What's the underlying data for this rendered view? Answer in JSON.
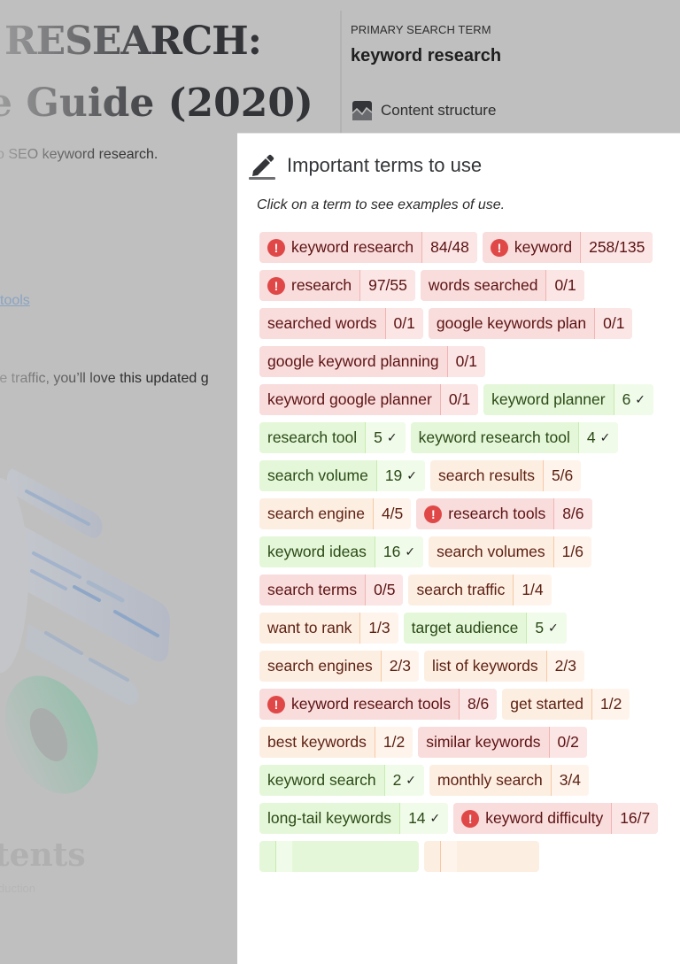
{
  "article": {
    "title_line1": "RESEARCH:",
    "title_line2": "e Guide (2020)",
    "subtitle": "o SEO keyword research.",
    "link_text": "tools",
    "paragraph": "re traffic, you’ll love this updated g",
    "contents_heading": "tents",
    "contents_item": "duction"
  },
  "sidebar": {
    "primary_label": "PRIMARY SEARCH TERM",
    "primary_value": "keyword research",
    "content_structure_label": "Content structure",
    "content_structure_icon": "chart-line-icon"
  },
  "panel": {
    "icon": "pencil-icon",
    "title": "Important terms to use",
    "hint": "Click on a term to see examples of use.",
    "status_colors": {
      "overused": "#f9dcdc",
      "good": "#e5f7d9",
      "underused": "#fdeee2",
      "alert": "#e04848"
    },
    "terms": [
      {
        "term": "keyword research",
        "count": "84/48",
        "status": "red",
        "alert": true
      },
      {
        "term": "keyword",
        "count": "258/135",
        "status": "red",
        "alert": true
      },
      {
        "term": "research",
        "count": "97/55",
        "status": "red",
        "alert": true
      },
      {
        "term": "words searched",
        "count": "0/1",
        "status": "red",
        "alert": false
      },
      {
        "term": "searched words",
        "count": "0/1",
        "status": "red",
        "alert": false
      },
      {
        "term": "google keywords plan",
        "count": "0/1",
        "status": "red",
        "alert": false
      },
      {
        "term": "google keyword planning",
        "count": "0/1",
        "status": "red",
        "alert": false
      },
      {
        "term": "keyword google planner",
        "count": "0/1",
        "status": "red",
        "alert": false
      },
      {
        "term": "keyword planner",
        "count": "6",
        "status": "green",
        "check": true
      },
      {
        "term": "research tool",
        "count": "5",
        "status": "green",
        "check": true
      },
      {
        "term": "keyword research tool",
        "count": "4",
        "status": "green",
        "check": true
      },
      {
        "term": "search volume",
        "count": "19",
        "status": "green",
        "check": true
      },
      {
        "term": "search results",
        "count": "5/6",
        "status": "orange",
        "alert": false
      },
      {
        "term": "search engine",
        "count": "4/5",
        "status": "orange",
        "alert": false
      },
      {
        "term": "research tools",
        "count": "8/6",
        "status": "red",
        "alert": true
      },
      {
        "term": "keyword ideas",
        "count": "16",
        "status": "green",
        "check": true
      },
      {
        "term": "search volumes",
        "count": "1/6",
        "status": "orange",
        "alert": false
      },
      {
        "term": "search terms",
        "count": "0/5",
        "status": "red",
        "alert": false
      },
      {
        "term": "search traffic",
        "count": "1/4",
        "status": "orange",
        "alert": false
      },
      {
        "term": "want to rank",
        "count": "1/3",
        "status": "orange",
        "alert": false
      },
      {
        "term": "target audience",
        "count": "5",
        "status": "green",
        "check": true
      },
      {
        "term": "search engines",
        "count": "2/3",
        "status": "orange",
        "alert": false
      },
      {
        "term": "list of keywords",
        "count": "2/3",
        "status": "orange",
        "alert": false
      },
      {
        "term": "keyword research tools",
        "count": "8/6",
        "status": "red",
        "alert": true
      },
      {
        "term": "get started",
        "count": "1/2",
        "status": "orange",
        "alert": false
      },
      {
        "term": "best keywords",
        "count": "1/2",
        "status": "orange",
        "alert": false
      },
      {
        "term": "similar keywords",
        "count": "0/2",
        "status": "red",
        "alert": false
      },
      {
        "term": "keyword search",
        "count": "2",
        "status": "green",
        "check": true
      },
      {
        "term": "monthly search",
        "count": "3/4",
        "status": "orange",
        "alert": false
      },
      {
        "term": "long-tail keywords",
        "count": "14",
        "status": "green",
        "check": true
      },
      {
        "term": "keyword difficulty",
        "count": "16/7",
        "status": "red",
        "alert": true
      },
      {
        "term": "",
        "count": "",
        "status": "green",
        "check": false
      },
      {
        "term": "",
        "count": "",
        "status": "orange",
        "alert": false
      }
    ]
  }
}
